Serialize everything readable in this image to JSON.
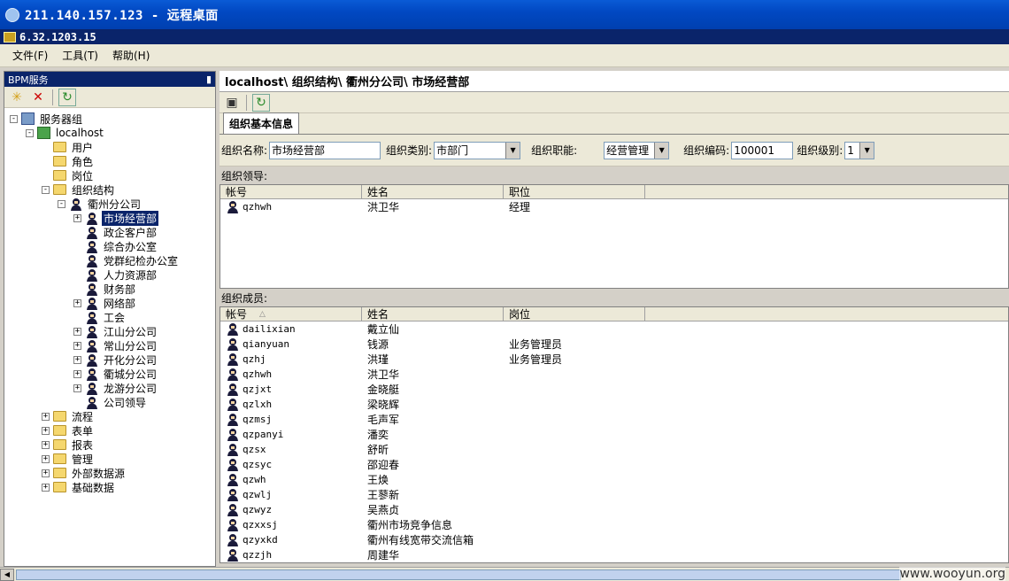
{
  "window": {
    "title": "211.140.157.123 - 远程桌面",
    "app_title": "6.32.1203.15"
  },
  "menu": [
    {
      "label": "文件(F)"
    },
    {
      "label": "工具(T)"
    },
    {
      "label": "帮助(H)"
    }
  ],
  "left": {
    "header": "BPM服务",
    "pin": "ᵖ",
    "tree": [
      {
        "label": "服务器组",
        "level": 0,
        "exp": "-",
        "icon": "server-icon"
      },
      {
        "label": "localhost",
        "level": 1,
        "exp": "-",
        "icon": "host-icon"
      },
      {
        "label": "用户",
        "level": 2,
        "exp": "",
        "icon": "folder-icon"
      },
      {
        "label": "角色",
        "level": 2,
        "exp": "",
        "icon": "folder-icon"
      },
      {
        "label": "岗位",
        "level": 2,
        "exp": "",
        "icon": "folder-icon"
      },
      {
        "label": "组织结构",
        "level": 2,
        "exp": "-",
        "icon": "folder-icon"
      },
      {
        "label": "衢州分公司",
        "level": 3,
        "exp": "-",
        "icon": "org-icon"
      },
      {
        "label": "市场经营部",
        "level": 4,
        "exp": "+",
        "icon": "org-icon",
        "selected": true
      },
      {
        "label": "政企客户部",
        "level": 4,
        "exp": "",
        "icon": "org-icon"
      },
      {
        "label": "综合办公室",
        "level": 4,
        "exp": "",
        "icon": "org-icon"
      },
      {
        "label": "党群纪检办公室",
        "level": 4,
        "exp": "",
        "icon": "org-icon"
      },
      {
        "label": "人力资源部",
        "level": 4,
        "exp": "",
        "icon": "org-icon"
      },
      {
        "label": "财务部",
        "level": 4,
        "exp": "",
        "icon": "org-icon"
      },
      {
        "label": "网络部",
        "level": 4,
        "exp": "+",
        "icon": "org-icon"
      },
      {
        "label": "工会",
        "level": 4,
        "exp": "",
        "icon": "org-icon"
      },
      {
        "label": "江山分公司",
        "level": 4,
        "exp": "+",
        "icon": "org-icon"
      },
      {
        "label": "常山分公司",
        "level": 4,
        "exp": "+",
        "icon": "org-icon"
      },
      {
        "label": "开化分公司",
        "level": 4,
        "exp": "+",
        "icon": "org-icon"
      },
      {
        "label": "衢城分公司",
        "level": 4,
        "exp": "+",
        "icon": "org-icon"
      },
      {
        "label": "龙游分公司",
        "level": 4,
        "exp": "+",
        "icon": "org-icon"
      },
      {
        "label": "公司领导",
        "level": 4,
        "exp": "",
        "icon": "org-icon"
      },
      {
        "label": "流程",
        "level": 2,
        "exp": "+",
        "icon": "folder-icon"
      },
      {
        "label": "表单",
        "level": 2,
        "exp": "+",
        "icon": "folder-icon"
      },
      {
        "label": "报表",
        "level": 2,
        "exp": "+",
        "icon": "folder-icon"
      },
      {
        "label": "管理",
        "level": 2,
        "exp": "+",
        "icon": "folder-icon"
      },
      {
        "label": "外部数据源",
        "level": 2,
        "exp": "+",
        "icon": "folder-icon"
      },
      {
        "label": "基础数据",
        "level": 2,
        "exp": "+",
        "icon": "folder-icon"
      }
    ]
  },
  "right": {
    "breadcrumb": "localhost\\ 组织结构\\ 衢州分公司\\ 市场经营部",
    "tab": "组织基本信息",
    "form": {
      "name_label": "组织名称:",
      "name_value": "市场经营部",
      "type_label": "组织类别:",
      "type_value": "市部门",
      "func_label": "组织职能:",
      "func_value": "经营管理",
      "code_label": "组织编码:",
      "code_value": "100001",
      "level_label": "组织级别:",
      "level_value": "1"
    },
    "leaders": {
      "label": "组织领导:",
      "headers": [
        "帐号",
        "姓名",
        "职位"
      ],
      "rows": [
        {
          "account": "qzhwh",
          "name": "洪卫华",
          "position": "经理"
        }
      ]
    },
    "members": {
      "label": "组织成员:",
      "headers": [
        "帐号",
        "姓名",
        "岗位"
      ],
      "rows": [
        {
          "account": "dailixian",
          "name": "戴立仙",
          "post": ""
        },
        {
          "account": "qianyuan",
          "name": "钱源",
          "post": "业务管理员"
        },
        {
          "account": "qzhj",
          "name": "洪瑾",
          "post": "业务管理员"
        },
        {
          "account": "qzhwh",
          "name": "洪卫华",
          "post": ""
        },
        {
          "account": "qzjxt",
          "name": "金晓艇",
          "post": ""
        },
        {
          "account": "qzlxh",
          "name": "梁晓辉",
          "post": ""
        },
        {
          "account": "qzmsj",
          "name": "毛声军",
          "post": ""
        },
        {
          "account": "qzpanyi",
          "name": "潘奕",
          "post": ""
        },
        {
          "account": "qzsx",
          "name": "舒昕",
          "post": ""
        },
        {
          "account": "qzsyc",
          "name": "邵迎春",
          "post": ""
        },
        {
          "account": "qzwh",
          "name": "王焕",
          "post": ""
        },
        {
          "account": "qzwlj",
          "name": "王蓼新",
          "post": ""
        },
        {
          "account": "qzwyz",
          "name": "吴燕贞",
          "post": ""
        },
        {
          "account": "qzxxsj",
          "name": "衢州市场竞争信息",
          "post": ""
        },
        {
          "account": "qzyxkd",
          "name": "衢州有线宽带交流信箱",
          "post": ""
        },
        {
          "account": "qzzjh",
          "name": "周建华",
          "post": ""
        }
      ]
    }
  },
  "watermark": "www.wooyun.org"
}
